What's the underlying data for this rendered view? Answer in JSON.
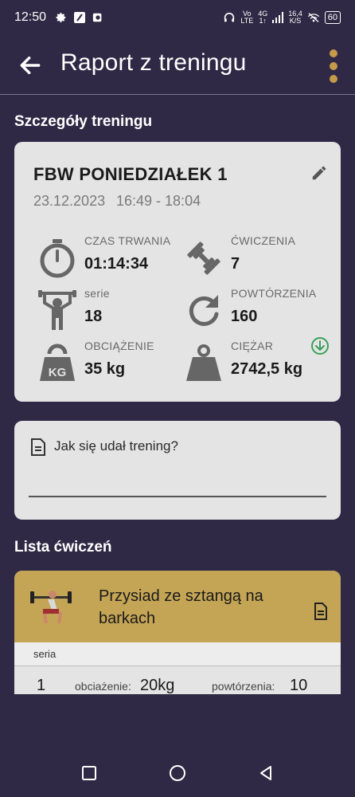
{
  "status": {
    "time": "12:50",
    "net_top": "Vo",
    "net_bottom": "LTE",
    "gen_top": "4G",
    "gen_bottom": "1↑",
    "speed_top": "16,4",
    "speed_bottom": "K/S",
    "battery": "60"
  },
  "appbar": {
    "title": "Raport z treningu"
  },
  "details": {
    "section_title": "Szczegóły treningu",
    "name": "FBW PONIEDZIAŁEK 1",
    "date": "23.12.2023",
    "time_range": "16:49 - 18:04",
    "stats": {
      "duration": {
        "label": "CZAS TRWANIA",
        "value": "01:14:34",
        "icon": "stopwatch-icon"
      },
      "exercises": {
        "label": "ĆWICZENIA",
        "value": "7",
        "icon": "dumbbell-icon"
      },
      "sets": {
        "label": "serie",
        "value": "18",
        "icon": "weightlifter-icon"
      },
      "reps": {
        "label": "POWTÓRZENIA",
        "value": "160",
        "icon": "refresh-icon"
      },
      "load": {
        "label": "OBCIĄŻENIE",
        "value": "35 kg",
        "icon": "kettlebell-kg-icon"
      },
      "weight": {
        "label": "CIĘŻAR",
        "value": "2742,5 kg",
        "icon": "weight-icon"
      }
    }
  },
  "note": {
    "placeholder": "Jak się udał trening?"
  },
  "exercise_list": {
    "section_title": "Lista ćwiczeń",
    "items": [
      {
        "name": "Przysiad ze sztangą na barkach",
        "sub_header": "seria",
        "rows": [
          {
            "number": "1",
            "load_label": "obciażenie:",
            "load_value": "20kg",
            "reps_label": "powtórzenia:",
            "reps_value": "10"
          }
        ]
      }
    ]
  },
  "colors": {
    "background": "#2f2945",
    "accent": "#c59a4a",
    "card": "#e4e4e4",
    "exercise_header": "#c4a455",
    "download": "#3aa05a"
  }
}
